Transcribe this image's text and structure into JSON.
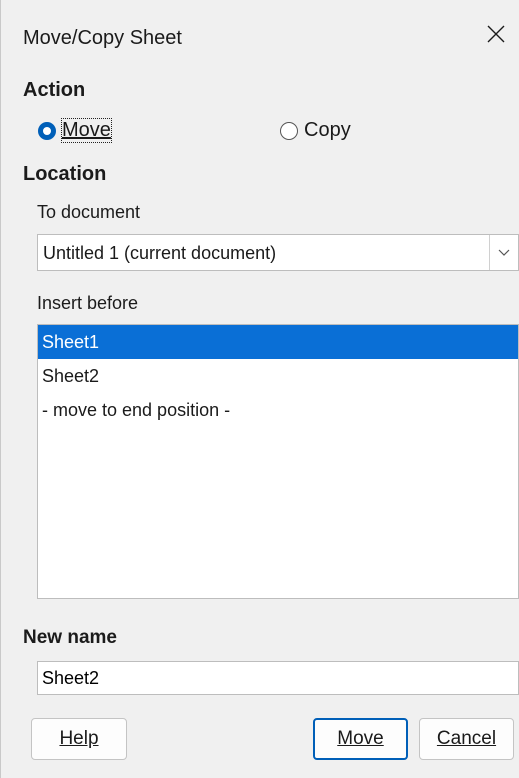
{
  "dialog": {
    "title": "Move/Copy Sheet",
    "close_icon": "close-icon"
  },
  "action": {
    "heading": "Action",
    "move_label": "Move",
    "copy_label": "Copy",
    "selected": "Move"
  },
  "location": {
    "heading": "Location",
    "to_document_label": "To document",
    "to_document_value": "Untitled 1 (current document)",
    "insert_before_label": "Insert before",
    "sheets": [
      "Sheet1",
      "Sheet2",
      "- move to end position -"
    ],
    "selected_index": 0
  },
  "new_name": {
    "label": "New name",
    "value": "Sheet2"
  },
  "buttons": {
    "help": "Help",
    "move": "Move",
    "cancel": "Cancel"
  },
  "colors": {
    "accent": "#005fb8",
    "selection": "#0a6fd6"
  }
}
